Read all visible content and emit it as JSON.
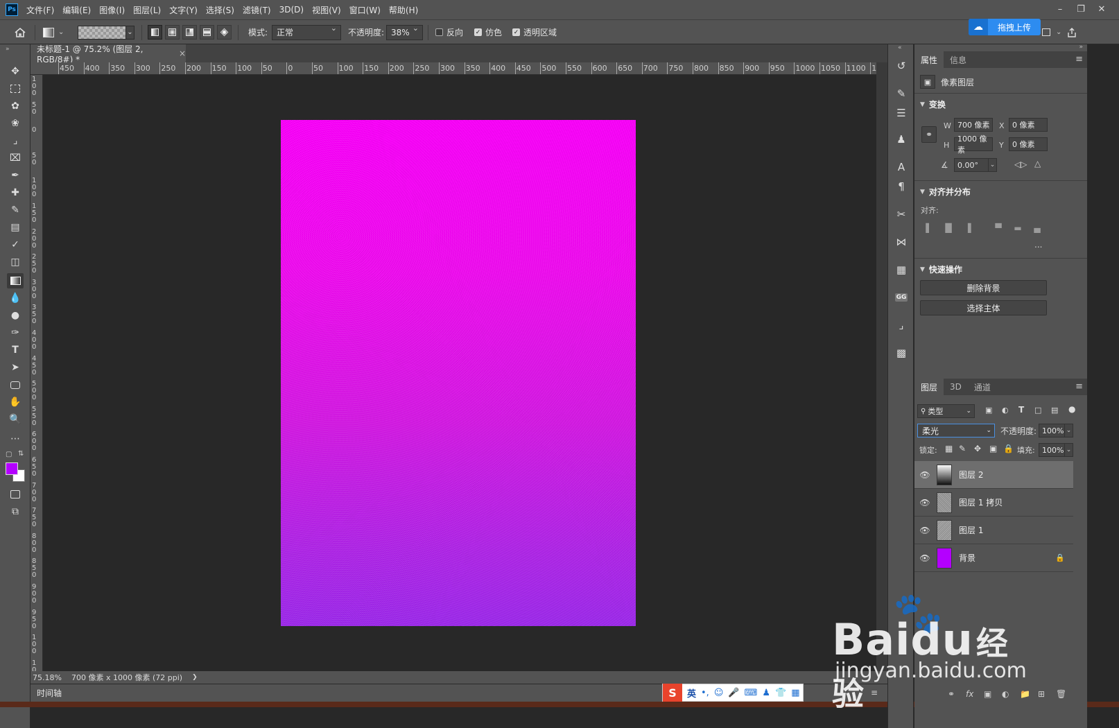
{
  "app": {
    "logo": "Ps"
  },
  "menu": [
    "文件(F)",
    "编辑(E)",
    "图像(I)",
    "图层(L)",
    "文字(Y)",
    "选择(S)",
    "滤镜(T)",
    "3D(D)",
    "视图(V)",
    "窗口(W)",
    "帮助(H)"
  ],
  "window_controls": {
    "minimize": "–",
    "restore": "❐",
    "close": "✕"
  },
  "options": {
    "mode_label": "模式:",
    "mode_value": "正常",
    "opacity_label": "不透明度:",
    "opacity_value": "38%",
    "reverse_label": "反向",
    "reverse_checked": false,
    "dither_label": "仿色",
    "dither_checked": true,
    "transparency_label": "透明区域",
    "transparency_checked": true
  },
  "upload": {
    "label": "拖拽上传"
  },
  "document": {
    "tab_title": "未标题-1 @ 75.2% (图层 2, RGB/8#) *",
    "close": "×",
    "zoom": "75.18%",
    "dimensions": "700 像素 x 1000 像素 (72 ppi)",
    "status_arrow": "❯"
  },
  "ruler": {
    "top": [
      "450",
      "400",
      "350",
      "300",
      "250",
      "200",
      "150",
      "100",
      "50",
      "0",
      "50",
      "100",
      "150",
      "200",
      "250",
      "300",
      "350",
      "400",
      "450",
      "500",
      "550",
      "600",
      "650",
      "700",
      "750",
      "800",
      "850",
      "900",
      "950",
      "1000",
      "1050",
      "1100",
      "11"
    ],
    "left": [
      "1 0 0",
      "5 0",
      "0",
      "5 0",
      "1 0 0",
      "1 5 0",
      "2 0 0",
      "2 5 0",
      "3 0 0",
      "3 5 0",
      "4 0 0",
      "4 5 0",
      "5 0 0",
      "5 5 0",
      "6 0 0",
      "6 5 0",
      "7 0 0",
      "7 5 0",
      "8 0 0",
      "8 5 0",
      "9 0 0",
      "9 5 0",
      "1 0 0",
      "1 0 5"
    ]
  },
  "timeline": {
    "label": "时间轴"
  },
  "properties": {
    "tabs": [
      "属性",
      "信息"
    ],
    "layer_type": "像素图层",
    "transform": {
      "title": "变换",
      "w_label": "W",
      "w_value": "700 像素",
      "h_label": "H",
      "h_value": "1000 像素",
      "x_label": "X",
      "x_value": "0 像素",
      "y_label": "Y",
      "y_value": "0 像素",
      "angle_value": "0.00°"
    },
    "align": {
      "title": "对齐并分布",
      "label": "对齐:",
      "more": "..."
    },
    "quick": {
      "title": "快速操作",
      "remove_bg": "删除背景",
      "select_subject": "选择主体"
    }
  },
  "layers_panel": {
    "tabs": [
      "图层",
      "3D",
      "通道"
    ],
    "filter_value": "类型",
    "blend_mode": "柔光",
    "opacity_label": "不透明度:",
    "opacity_value": "100%",
    "lock_label": "锁定:",
    "fill_label": "填充:",
    "fill_value": "100%",
    "layers": [
      {
        "name": "图层 2",
        "selected": true,
        "thumb": "gradient"
      },
      {
        "name": "图层 1 拷贝",
        "selected": false,
        "thumb": "noise"
      },
      {
        "name": "图层 1",
        "selected": false,
        "thumb": "noise"
      },
      {
        "name": "背景",
        "selected": false,
        "thumb": "purple",
        "locked": true
      }
    ],
    "footer_icons": [
      "link-icon",
      "fx-icon",
      "mask-icon",
      "adjustment-icon",
      "folder-icon",
      "new-layer-icon",
      "trash-icon"
    ]
  },
  "colors": {
    "foreground": "#b400ff",
    "background": "#ffffff",
    "canvas_top": "#ff00ff",
    "canvas_bottom": "#a02af0"
  },
  "ime": {
    "lang": "英"
  },
  "watermark": {
    "brand_a": "Bai",
    "brand_b": "du",
    "brand_c": "经验",
    "url": "jingyan.baidu.com"
  }
}
